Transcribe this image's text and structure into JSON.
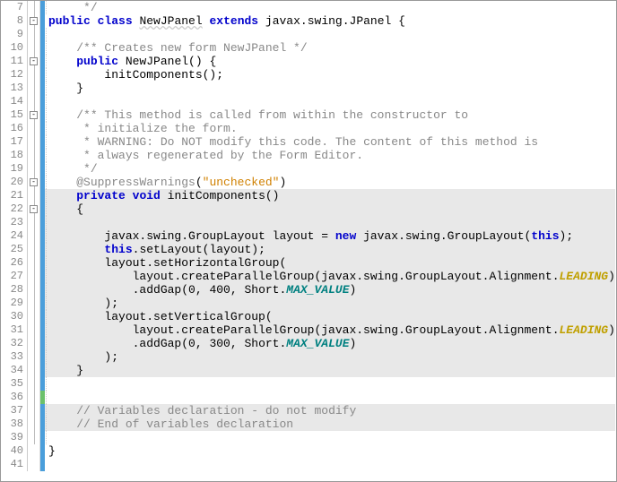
{
  "code": {
    "lines": [
      {
        "n": 7,
        "fold": "",
        "foldline": true,
        "diff": "blue",
        "hl": false,
        "guide": true,
        "tokens": [
          [
            "     ",
            ""
          ],
          [
            "*/",
            "cm"
          ]
        ]
      },
      {
        "n": 8,
        "fold": "-",
        "foldline": true,
        "diff": "blue",
        "hl": false,
        "guide": false,
        "tokens": [
          [
            "public",
            "kw"
          ],
          [
            " ",
            ""
          ],
          [
            "class",
            "kw"
          ],
          [
            " ",
            ""
          ],
          [
            "NewJPanel",
            "cls cls-u"
          ],
          [
            " ",
            ""
          ],
          [
            "extends",
            "kw"
          ],
          [
            " ",
            ""
          ],
          [
            "javax.swing.JPanel {",
            ""
          ]
        ]
      },
      {
        "n": 9,
        "fold": "",
        "foldline": true,
        "diff": "blue",
        "hl": false,
        "guide": true,
        "tokens": [
          [
            "",
            ""
          ]
        ]
      },
      {
        "n": 10,
        "fold": "",
        "foldline": true,
        "diff": "blue",
        "hl": false,
        "guide": true,
        "tokens": [
          [
            "    ",
            ""
          ],
          [
            "/** Creates new form NewJPanel */",
            "cm"
          ]
        ]
      },
      {
        "n": 11,
        "fold": "-",
        "foldline": true,
        "diff": "blue",
        "hl": false,
        "guide": true,
        "tokens": [
          [
            "    ",
            ""
          ],
          [
            "public",
            "kw"
          ],
          [
            " NewJPanel() {",
            ""
          ]
        ]
      },
      {
        "n": 12,
        "fold": "",
        "foldline": true,
        "diff": "blue",
        "hl": false,
        "guide": true,
        "tokens": [
          [
            "        initComponents();",
            ""
          ]
        ]
      },
      {
        "n": 13,
        "fold": "",
        "foldline": true,
        "diff": "blue",
        "hl": false,
        "guide": true,
        "tokens": [
          [
            "    }",
            ""
          ]
        ]
      },
      {
        "n": 14,
        "fold": "",
        "foldline": true,
        "diff": "blue",
        "hl": false,
        "guide": true,
        "tokens": [
          [
            "",
            ""
          ]
        ]
      },
      {
        "n": 15,
        "fold": "-",
        "foldline": true,
        "diff": "blue",
        "hl": false,
        "guide": true,
        "tokens": [
          [
            "    ",
            ""
          ],
          [
            "/** This method is called from within the constructor to",
            "cm"
          ]
        ]
      },
      {
        "n": 16,
        "fold": "",
        "foldline": true,
        "diff": "blue",
        "hl": false,
        "guide": true,
        "tokens": [
          [
            "     ",
            ""
          ],
          [
            "* initialize the form.",
            "cm"
          ]
        ]
      },
      {
        "n": 17,
        "fold": "",
        "foldline": true,
        "diff": "blue",
        "hl": false,
        "guide": true,
        "tokens": [
          [
            "     ",
            ""
          ],
          [
            "* WARNING: Do NOT modify this code. The content of this method is",
            "cm"
          ]
        ]
      },
      {
        "n": 18,
        "fold": "",
        "foldline": true,
        "diff": "blue",
        "hl": false,
        "guide": true,
        "tokens": [
          [
            "     ",
            ""
          ],
          [
            "* always regenerated by the Form Editor.",
            "cm"
          ]
        ]
      },
      {
        "n": 19,
        "fold": "",
        "foldline": true,
        "diff": "blue",
        "hl": false,
        "guide": true,
        "tokens": [
          [
            "     ",
            ""
          ],
          [
            "*/",
            "cm"
          ]
        ]
      },
      {
        "n": 20,
        "fold": "-",
        "foldline": true,
        "diff": "blue",
        "hl": false,
        "guide": true,
        "tokens": [
          [
            "    ",
            ""
          ],
          [
            "@SuppressWarnings",
            "ann"
          ],
          [
            "(",
            ""
          ],
          [
            "\"unchecked\"",
            "str"
          ],
          [
            ")",
            ""
          ]
        ]
      },
      {
        "n": 21,
        "fold": "",
        "foldline": true,
        "diff": "blue",
        "hl": true,
        "guide": true,
        "tokens": [
          [
            "    ",
            ""
          ],
          [
            "private",
            "kw"
          ],
          [
            " ",
            ""
          ],
          [
            "void",
            "kw"
          ],
          [
            " initComponents()",
            ""
          ]
        ]
      },
      {
        "n": 22,
        "fold": "-",
        "foldline": true,
        "diff": "blue",
        "hl": true,
        "guide": true,
        "tokens": [
          [
            "    {",
            ""
          ]
        ]
      },
      {
        "n": 23,
        "fold": "",
        "foldline": true,
        "diff": "blue",
        "hl": true,
        "guide": true,
        "tokens": [
          [
            "",
            ""
          ]
        ]
      },
      {
        "n": 24,
        "fold": "",
        "foldline": true,
        "diff": "blue",
        "hl": true,
        "guide": true,
        "tokens": [
          [
            "        javax.swing.GroupLayout layout = ",
            ""
          ],
          [
            "new",
            "kw"
          ],
          [
            " javax.swing.GroupLayout(",
            ""
          ],
          [
            "this",
            "this"
          ],
          [
            ");",
            ""
          ]
        ]
      },
      {
        "n": 25,
        "fold": "",
        "foldline": true,
        "diff": "blue",
        "hl": true,
        "guide": true,
        "tokens": [
          [
            "        ",
            ""
          ],
          [
            "this",
            "this"
          ],
          [
            ".setLayout(layout);",
            ""
          ]
        ]
      },
      {
        "n": 26,
        "fold": "",
        "foldline": true,
        "diff": "blue",
        "hl": true,
        "guide": true,
        "tokens": [
          [
            "        layout.setHorizontalGroup(",
            ""
          ]
        ]
      },
      {
        "n": 27,
        "fold": "",
        "foldline": true,
        "diff": "blue",
        "hl": true,
        "guide": true,
        "tokens": [
          [
            "            layout.createParallelGroup(javax.swing.GroupLayout.Alignment.",
            ""
          ],
          [
            "LEADING",
            "lead"
          ],
          [
            ")",
            ""
          ]
        ]
      },
      {
        "n": 28,
        "fold": "",
        "foldline": true,
        "diff": "blue",
        "hl": true,
        "guide": true,
        "tokens": [
          [
            "            .addGap(",
            ""
          ],
          [
            "0",
            "num"
          ],
          [
            ", ",
            ""
          ],
          [
            "400",
            "num"
          ],
          [
            ", Short.",
            ""
          ],
          [
            "MAX_VALUE",
            "const"
          ],
          [
            ")",
            ""
          ]
        ]
      },
      {
        "n": 29,
        "fold": "",
        "foldline": true,
        "diff": "blue",
        "hl": true,
        "guide": true,
        "tokens": [
          [
            "        );",
            ""
          ]
        ]
      },
      {
        "n": 30,
        "fold": "",
        "foldline": true,
        "diff": "blue",
        "hl": true,
        "guide": true,
        "tokens": [
          [
            "        layout.setVerticalGroup(",
            ""
          ]
        ]
      },
      {
        "n": 31,
        "fold": "",
        "foldline": true,
        "diff": "blue",
        "hl": true,
        "guide": true,
        "tokens": [
          [
            "            layout.createParallelGroup(javax.swing.GroupLayout.Alignment.",
            ""
          ],
          [
            "LEADING",
            "lead"
          ],
          [
            ")",
            ""
          ]
        ]
      },
      {
        "n": 32,
        "fold": "",
        "foldline": true,
        "diff": "blue",
        "hl": true,
        "guide": true,
        "tokens": [
          [
            "            .addGap(",
            ""
          ],
          [
            "0",
            "num"
          ],
          [
            ", ",
            ""
          ],
          [
            "300",
            "num"
          ],
          [
            ", Short.",
            ""
          ],
          [
            "MAX_VALUE",
            "const"
          ],
          [
            ")",
            ""
          ]
        ]
      },
      {
        "n": 33,
        "fold": "",
        "foldline": true,
        "diff": "blue",
        "hl": true,
        "guide": true,
        "tokens": [
          [
            "        );",
            ""
          ]
        ]
      },
      {
        "n": 34,
        "fold": "",
        "foldline": true,
        "diff": "blue",
        "hl": true,
        "guide": true,
        "tokens": [
          [
            "    }",
            ""
          ]
        ]
      },
      {
        "n": 35,
        "fold": "",
        "foldline": true,
        "diff": "blue",
        "hl": false,
        "guide": true,
        "tokens": [
          [
            "",
            ""
          ]
        ]
      },
      {
        "n": 36,
        "fold": "",
        "foldline": true,
        "diff": "green",
        "hl": false,
        "guide": true,
        "tokens": [
          [
            "",
            ""
          ]
        ]
      },
      {
        "n": 37,
        "fold": "",
        "foldline": true,
        "diff": "blue",
        "hl": true,
        "guide": true,
        "tokens": [
          [
            "    ",
            ""
          ],
          [
            "// Variables declaration - do not modify",
            "cm"
          ]
        ]
      },
      {
        "n": 38,
        "fold": "",
        "foldline": true,
        "diff": "blue",
        "hl": true,
        "guide": true,
        "tokens": [
          [
            "    ",
            ""
          ],
          [
            "// End of variables declaration",
            "cm"
          ]
        ]
      },
      {
        "n": 39,
        "fold": "",
        "foldline": true,
        "diff": "blue",
        "hl": false,
        "guide": true,
        "tokens": [
          [
            "",
            ""
          ]
        ]
      },
      {
        "n": 40,
        "fold": "",
        "foldline": false,
        "diff": "blue",
        "hl": false,
        "guide": false,
        "tokens": [
          [
            "}",
            ""
          ]
        ]
      },
      {
        "n": 41,
        "fold": "",
        "foldline": false,
        "diff": "blue",
        "hl": false,
        "guide": false,
        "tokens": [
          [
            "",
            ""
          ]
        ]
      }
    ]
  }
}
